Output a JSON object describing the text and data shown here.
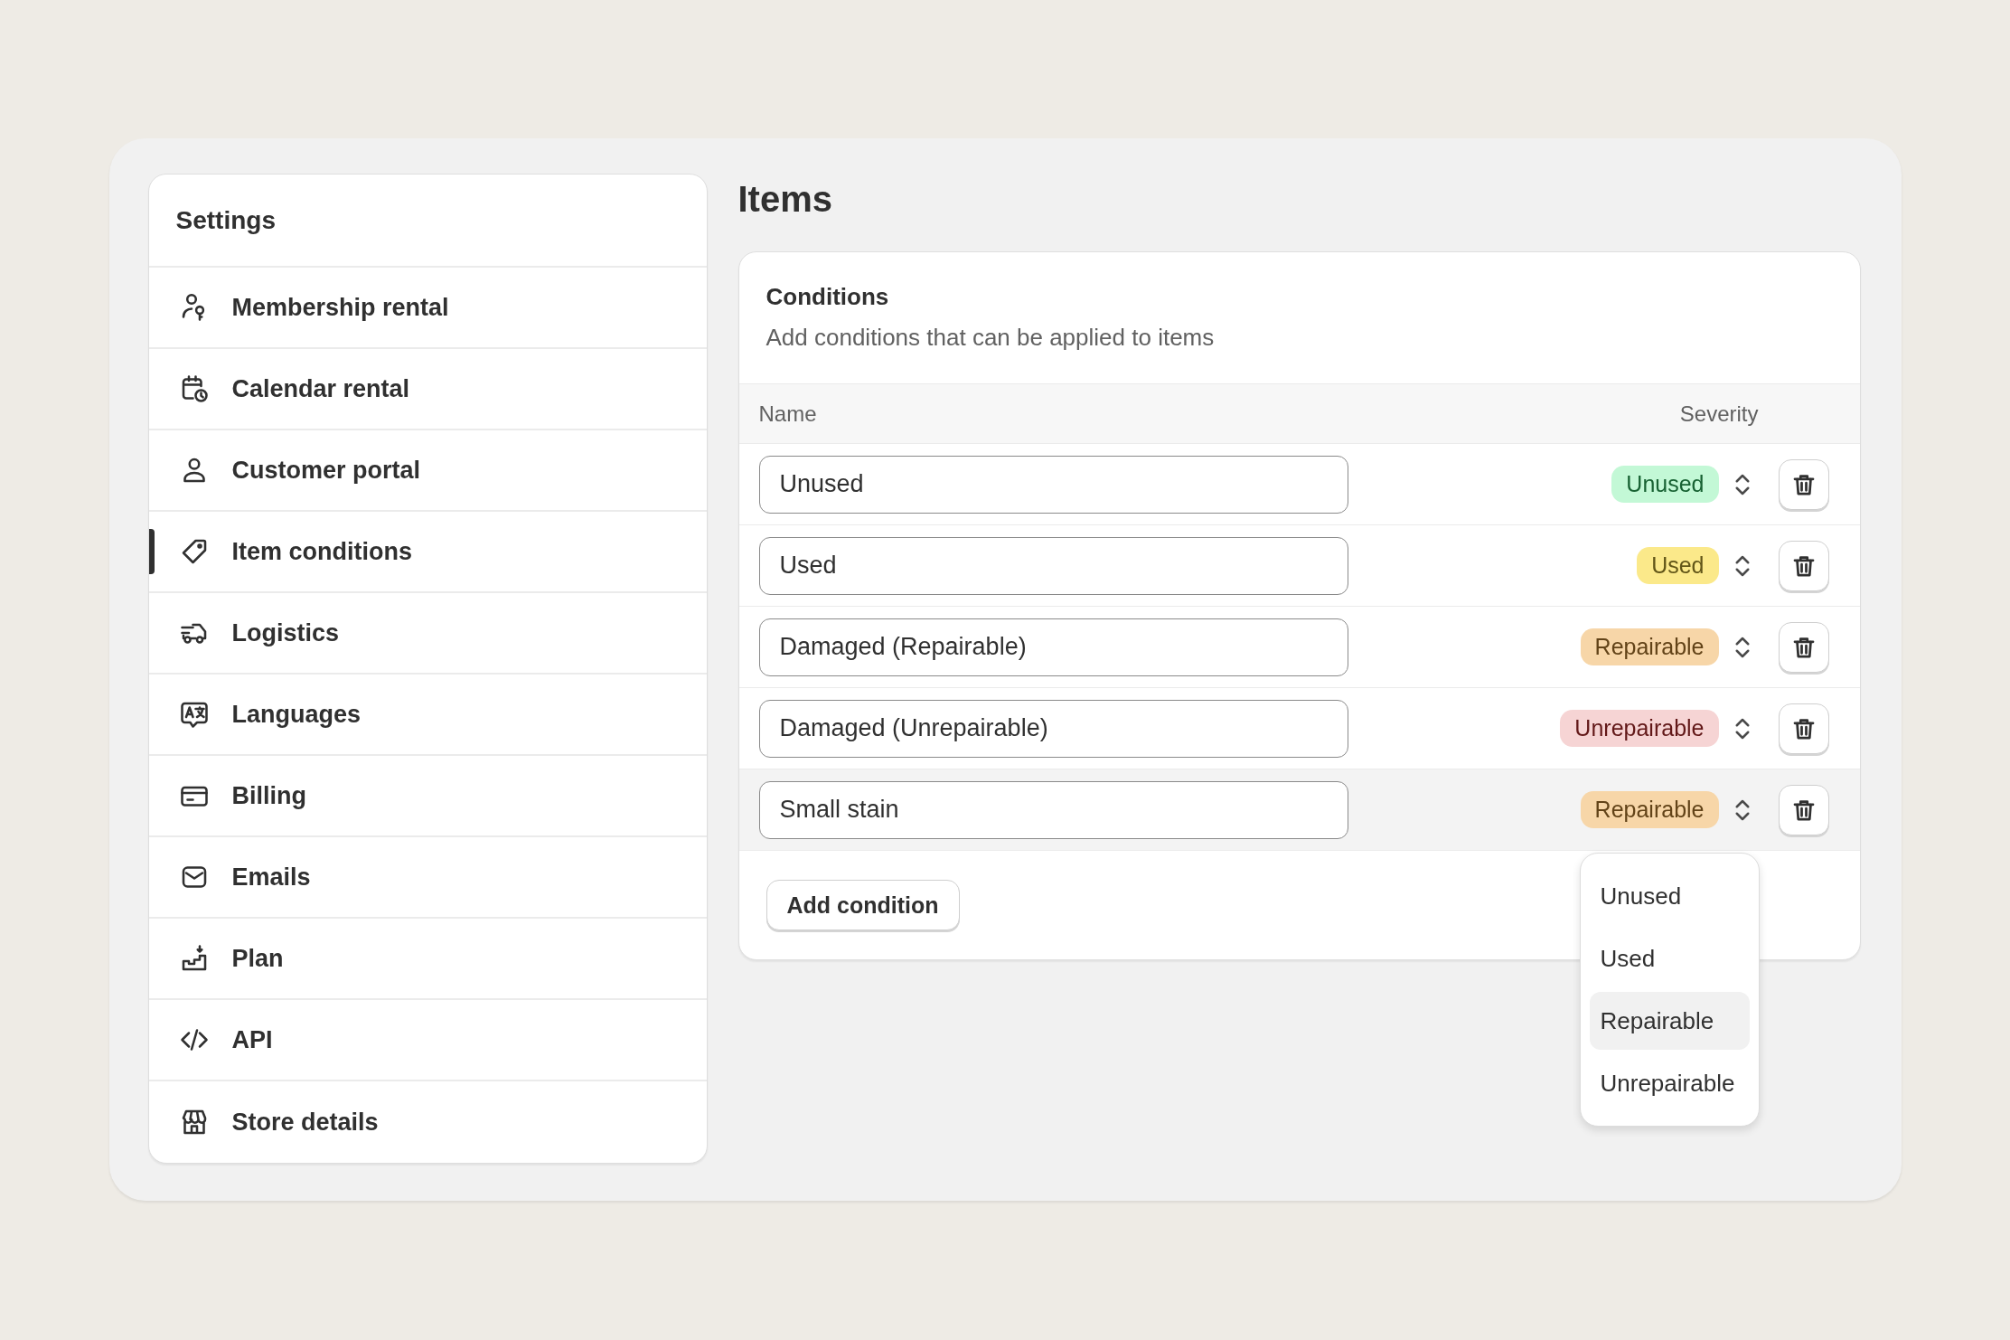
{
  "sidebar": {
    "title": "Settings",
    "items": [
      {
        "label": "Membership rental",
        "selected": false
      },
      {
        "label": "Calendar rental",
        "selected": false
      },
      {
        "label": "Customer portal",
        "selected": false
      },
      {
        "label": "Item conditions",
        "selected": true
      },
      {
        "label": "Logistics",
        "selected": false
      },
      {
        "label": "Languages",
        "selected": false
      },
      {
        "label": "Billing",
        "selected": false
      },
      {
        "label": "Emails",
        "selected": false
      },
      {
        "label": "Plan",
        "selected": false
      },
      {
        "label": "API",
        "selected": false
      },
      {
        "label": "Store details",
        "selected": false
      }
    ]
  },
  "page": {
    "title": "Items"
  },
  "conditions": {
    "title": "Conditions",
    "subtitle": "Add conditions that can be applied to items",
    "columns": [
      "Name",
      "Severity"
    ],
    "rows": [
      {
        "name": "Unused",
        "severity": "Unused",
        "color": "#c3f8d6",
        "highlighted": false
      },
      {
        "name": "Used",
        "severity": "Used",
        "color": "#fbe98a",
        "highlighted": false
      },
      {
        "name": "Damaged (Repairable)",
        "severity": "Repairable",
        "color": "#f7d6a8",
        "highlighted": false
      },
      {
        "name": "Damaged (Unrepairable)",
        "severity": "Unrepairable",
        "color": "#f6d4d4",
        "highlighted": false
      },
      {
        "name": "Small stain",
        "severity": "Repairable",
        "color": "#f7d6a8",
        "highlighted": true
      }
    ],
    "add_button": "Add condition",
    "dropdown": {
      "options": [
        {
          "label": "Unused",
          "selected": false
        },
        {
          "label": "Used",
          "selected": false
        },
        {
          "label": "Repairable",
          "selected": true
        },
        {
          "label": "Unrepairable",
          "selected": false
        }
      ]
    }
  }
}
